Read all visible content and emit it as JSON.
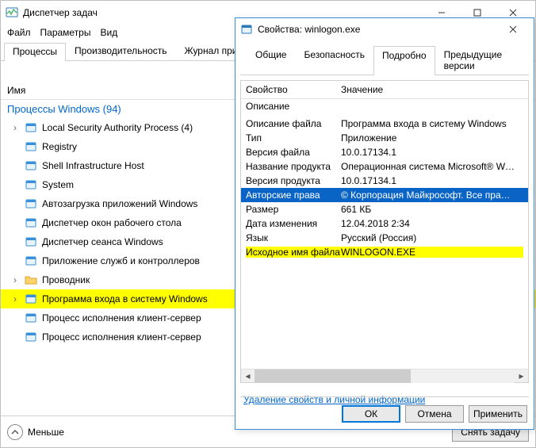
{
  "taskmgr": {
    "title": "Диспетчер задач",
    "menu": {
      "file": "Файл",
      "options": "Параметры",
      "view": "Вид"
    },
    "tabs": [
      "Процессы",
      "Производительность",
      "Журнал прилож"
    ],
    "active_tab": 0,
    "header": {
      "name": "Имя"
    },
    "group_label": "Процессы Windows (94)",
    "items": [
      {
        "label": "Local Security Authority Process (4)",
        "expandable": true
      },
      {
        "label": "Registry",
        "expandable": false
      },
      {
        "label": "Shell Infrastructure Host",
        "expandable": false
      },
      {
        "label": "System",
        "expandable": false
      },
      {
        "label": "Автозагрузка приложений Windows",
        "expandable": false
      },
      {
        "label": "Диспетчер окон рабочего стола",
        "expandable": false
      },
      {
        "label": "Диспетчер сеанса  Windows",
        "expandable": false
      },
      {
        "label": "Приложение служб и контроллеров",
        "expandable": false
      },
      {
        "label": "Проводник",
        "expandable": true,
        "folder": true
      },
      {
        "label": "Программа входа в систему Windows",
        "expandable": true,
        "highlight": true
      },
      {
        "label": "Процесс исполнения клиент-сервер",
        "expandable": false
      },
      {
        "label": "Процесс исполнения клиент-сервер",
        "expandable": false
      }
    ],
    "fewer": "Меньше",
    "end_task": "Снять задачу"
  },
  "props": {
    "title": "Свойства: winlogon.exe",
    "tabs": [
      "Общие",
      "Безопасность",
      "Подробно",
      "Предыдущие версии"
    ],
    "active_tab": 2,
    "col_property": "Свойство",
    "col_value": "Значение",
    "section": "Описание",
    "rows": [
      {
        "k": "Описание файла",
        "v": "Программа входа в систему Windows"
      },
      {
        "k": "Тип",
        "v": "Приложение"
      },
      {
        "k": "Версия файла",
        "v": "10.0.17134.1"
      },
      {
        "k": "Название продукта",
        "v": "Операционная система Microsoft® W…"
      },
      {
        "k": "Версия продукта",
        "v": "10.0.17134.1"
      },
      {
        "k": "Авторские права",
        "v": "© Корпорация Майкрософт. Все пра…",
        "selected": true
      },
      {
        "k": "Размер",
        "v": "661 КБ"
      },
      {
        "k": "Дата изменения",
        "v": "12.04.2018 2:34"
      },
      {
        "k": "Язык",
        "v": "Русский (Россия)"
      },
      {
        "k": "Исходное имя файла",
        "v": "WINLOGON.EXE",
        "yellow": true
      }
    ],
    "link": "Удаление свойств и личной информации",
    "ok": "ОК",
    "cancel": "Отмена",
    "apply": "Применить"
  }
}
